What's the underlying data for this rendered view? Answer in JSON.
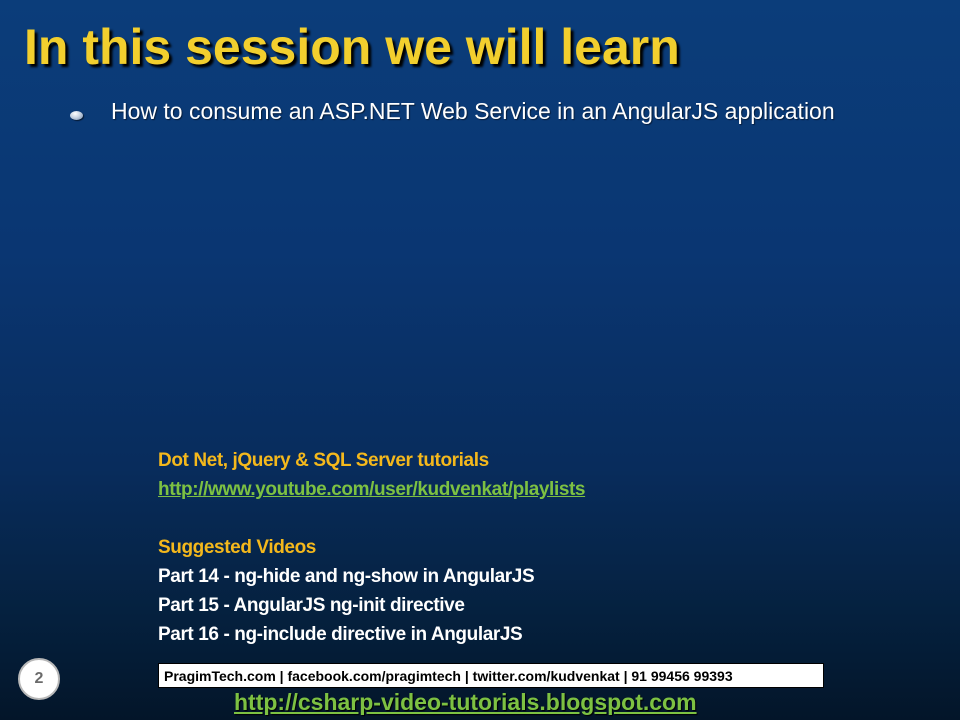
{
  "slide": {
    "title": "In this session we will learn",
    "bullets": [
      "How to consume an ASP.NET Web Service in an AngularJS application"
    ]
  },
  "info": {
    "heading": "Dot Net, jQuery & SQL Server tutorials",
    "playlist_link": "http://www.youtube.com/user/kudvenkat/playlists",
    "suggested_heading": "Suggested Videos",
    "suggested_videos": [
      "Part 14 - ng-hide and ng-show in AngularJS",
      "Part 15 - AngularJS ng-init directive",
      "Part 16 - ng-include directive in AngularJS"
    ]
  },
  "contact_bar": "PragimTech.com | facebook.com/pragimtech  | twitter.com/kudvenkat  | 91 99456 99393",
  "footer_link": "http://csharp-video-tutorials.blogspot.com",
  "slide_number": "2",
  "colors": {
    "title": "#f2cf2e",
    "gold_heading": "#f4b81c",
    "link_green": "#7dc142",
    "background_top": "#0b3d7a",
    "background_bottom": "#031529"
  }
}
